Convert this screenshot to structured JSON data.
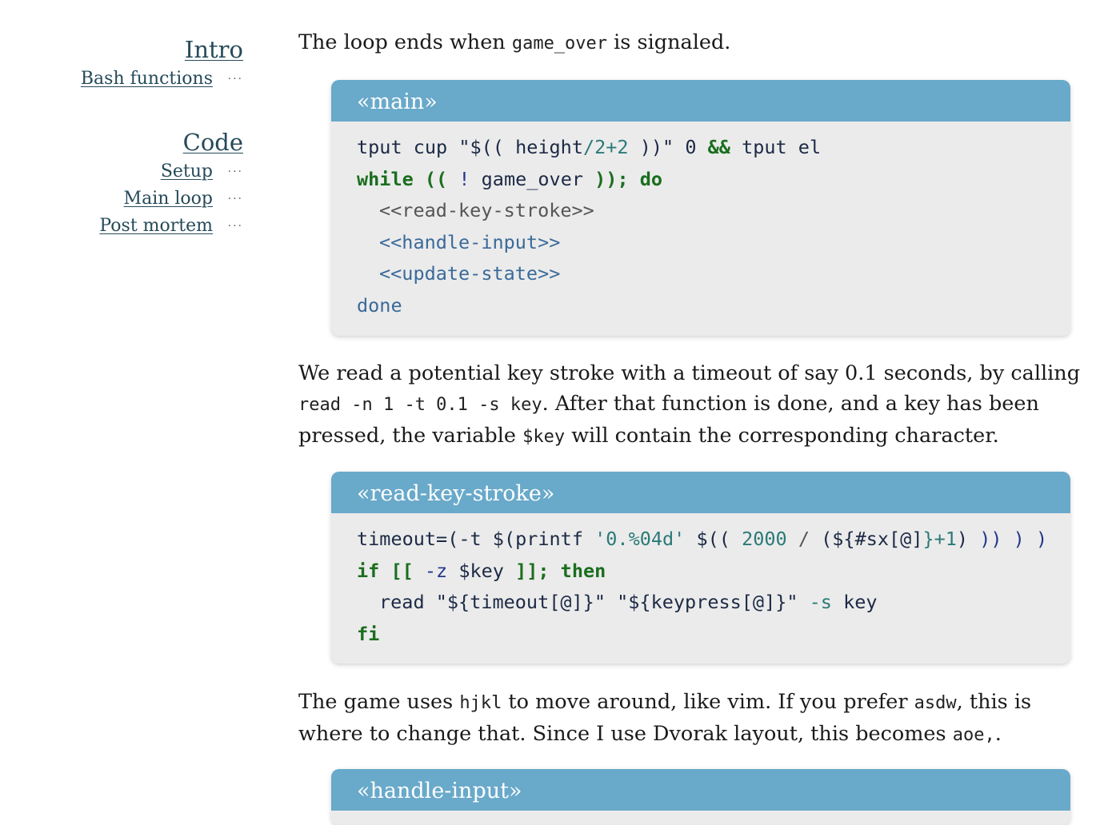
{
  "nav": {
    "groups": [
      {
        "heading": "Intro",
        "items": [
          {
            "label": "Bash functions",
            "dots": "···"
          }
        ]
      },
      {
        "heading": "Code",
        "items": [
          {
            "label": "Setup",
            "dots": "···"
          },
          {
            "label": "Main loop",
            "dots": "···"
          },
          {
            "label": "Post mortem",
            "dots": "···"
          }
        ]
      }
    ]
  },
  "content": {
    "para1": {
      "before": "The loop ends when ",
      "code": "game_over",
      "after": " is signaled."
    },
    "block_main": {
      "title": "«main»",
      "lines": [
        [
          "tput",
          " cup ",
          "\"$((",
          " height",
          "/2+2",
          " ))\"",
          " 0 ",
          "&&",
          " tput el"
        ],
        [
          "while",
          " ((",
          " ! ",
          "game_over",
          " ));",
          " do"
        ],
        [
          "<<read-key-stroke>>"
        ],
        [
          "<<handle-input>>"
        ],
        [
          "<<update-state>>"
        ],
        [
          "done"
        ]
      ]
    },
    "para2": {
      "t1": "We read a potential key stroke with a timeout of say 0.1 seconds, by calling ",
      "c1": "read -n 1 -t 0.1 -s key",
      "t2": ". After that function is done, and a key has been pressed, the variable ",
      "c2": "$key",
      "t3": " will contain the corresponding character."
    },
    "block_read": {
      "title": "«read-key-stroke»",
      "lines": [
        [
          "timeout",
          "=(-t ",
          "$(printf ",
          "'0.%04d'",
          " $((",
          " 2000",
          " / ",
          "(${",
          "#sx[@]",
          "}+1",
          ")",
          " ))",
          " )",
          " )"
        ],
        [
          "if",
          " [[",
          " -z ",
          "$key",
          " ]];",
          " then"
        ],
        [
          "read ",
          "\"${timeout[@]}\"",
          " ",
          "\"${keypress[@]}\"",
          " -s",
          " key"
        ],
        [
          "fi"
        ]
      ]
    },
    "para3": {
      "t1": "The game uses ",
      "c1": "hjkl",
      "t2": " to move around, like vim. If you prefer ",
      "c2": "asdw",
      "t3": ", this is where to change that. Since I use Dvorak layout, this becomes ",
      "c3": "aoe,",
      "t4": "."
    },
    "block_handle": {
      "title": "«handle-input»"
    }
  }
}
